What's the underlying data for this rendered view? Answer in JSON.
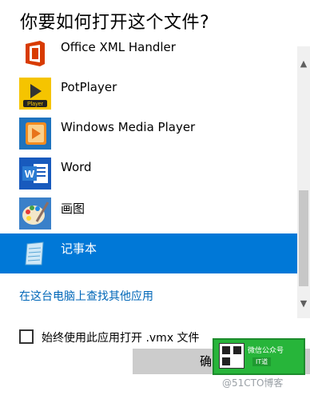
{
  "dialog": {
    "title": "你要如何打开这个文件?",
    "apps": [
      {
        "label": "Office XML Handler",
        "icon": "office-xml-handler-icon"
      },
      {
        "label": "PotPlayer",
        "icon": "potplayer-icon"
      },
      {
        "label": "Windows Media Player",
        "icon": "windows-media-player-icon"
      },
      {
        "label": "Word",
        "icon": "word-icon"
      },
      {
        "label": "画图",
        "icon": "paint-icon"
      },
      {
        "label": "记事本",
        "icon": "notepad-icon",
        "selected": true
      }
    ],
    "more_apps_link": "在这台电脑上查找其他应用",
    "always_use_label": "始终使用此应用打开 .vmx 文件",
    "always_use_checked": false,
    "ok_button": "确",
    "potplayer_icon_text": "Player",
    "word_icon_text": "W"
  },
  "watermark": {
    "wechat_text": "微信公众号",
    "wechat_sub": "IT道",
    "blog_text": "@51CTO博客"
  },
  "colors": {
    "accent": "#0078d7",
    "link": "#0067b8",
    "office_red": "#d83b01",
    "potplayer_yellow": "#f5c400",
    "wmp_orange": "#f28b20",
    "word_blue": "#185abd"
  }
}
